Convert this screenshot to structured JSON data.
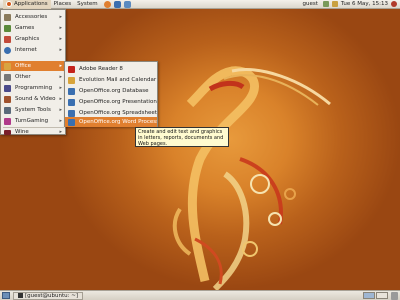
{
  "top_panel": {
    "applications": "Applications",
    "places": "Places",
    "system": "System",
    "user": "guest",
    "datetime": "Tue 6 May, 15:13"
  },
  "apps_menu": {
    "items": [
      {
        "label": "Accessories",
        "icon": "accessories-icon",
        "color": "#8a7a5a"
      },
      {
        "label": "Games",
        "icon": "games-icon",
        "color": "#5b8a3a"
      },
      {
        "label": "Graphics",
        "icon": "graphics-icon",
        "color": "#c24a3a"
      },
      {
        "label": "Internet",
        "icon": "internet-icon",
        "color": "#3a6fb0"
      },
      {
        "label": "Office",
        "icon": "office-icon",
        "color": "#d9a441"
      },
      {
        "label": "Other",
        "icon": "other-icon",
        "color": "#777777"
      },
      {
        "label": "Programming",
        "icon": "programming-icon",
        "color": "#4a4a8a"
      },
      {
        "label": "Sound & Video",
        "icon": "sound-video-icon",
        "color": "#a0522d"
      },
      {
        "label": "System Tools",
        "icon": "system-tools-icon",
        "color": "#5a6a7a"
      },
      {
        "label": "TurnGaming",
        "icon": "turngaming-icon",
        "color": "#b03a8a"
      },
      {
        "label": "Wine",
        "icon": "wine-icon",
        "color": "#7a1f2b"
      }
    ]
  },
  "office_menu": {
    "items": [
      {
        "label": "Adobe Reader 8",
        "icon": "adobe-reader-icon",
        "color": "#c4221a"
      },
      {
        "label": "Evolution Mail and Calendar",
        "icon": "evolution-icon",
        "color": "#d8a43a"
      },
      {
        "label": "OpenOffice.org Database",
        "icon": "ooo-database-icon",
        "color": "#3a6fb0"
      },
      {
        "label": "OpenOffice.org Presentation",
        "icon": "ooo-presentation-icon",
        "color": "#3a6fb0"
      },
      {
        "label": "OpenOffice.org Spreadsheet",
        "icon": "ooo-spreadsheet-icon",
        "color": "#3a6fb0"
      },
      {
        "label": "OpenOffice.org Word Processor",
        "icon": "ooo-writer-icon",
        "color": "#3a6fb0"
      }
    ]
  },
  "tooltip": {
    "text": "Create and edit text and graphics in letters, reports, documents and Web pages."
  },
  "bottom_panel": {
    "task": "[guest@ubuntu: ~]"
  },
  "colors": {
    "highlight": "#e07f2f",
    "wallpaper": "#d9822a"
  }
}
